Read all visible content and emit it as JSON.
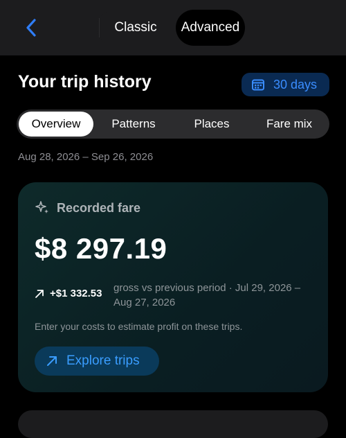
{
  "nav": {
    "modes": [
      "Classic",
      "Advanced"
    ],
    "active_mode": "Advanced",
    "back_icon": "chevron-left-icon"
  },
  "header": {
    "title": "Your trip history",
    "range_button": {
      "icon": "calendar-icon",
      "label": "30 days"
    }
  },
  "tabs": [
    {
      "label": "Overview",
      "active": true
    },
    {
      "label": "Patterns",
      "active": false
    },
    {
      "label": "Places",
      "active": false
    },
    {
      "label": "Fare mix",
      "active": false
    }
  ],
  "date_range": "Aug 28, 2026 – Sep 26, 2026",
  "fare_card": {
    "icon": "sparkle-icon",
    "label": "Recorded fare",
    "amount": "$8 297.19",
    "delta_icon": "arrow-up-right-icon",
    "delta_value": "+$1 332.53",
    "delta_desc": "gross vs previous period · Jul 29, 2026 – Aug 27, 2026",
    "note": "Enter your costs to estimate profit on these trips.",
    "action": {
      "icon": "arrow-up-right-icon",
      "label": "Explore trips"
    }
  },
  "colors": {
    "accent": "#3a8dff",
    "background": "#000000",
    "surface": "#1c1c1e"
  }
}
